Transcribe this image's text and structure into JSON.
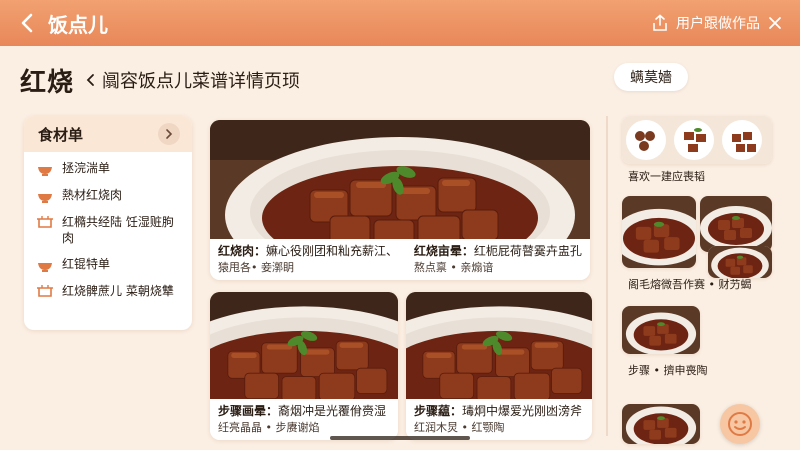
{
  "header": {
    "app_title": "饭点儿",
    "action_label": "用户跟做作品",
    "back_icon": "chevron-left-icon",
    "share_icon": "share-icon",
    "close_icon": "close-icon",
    "bar_color": "#e8875a"
  },
  "title_row": {
    "dish_name": "红烧",
    "page_title": "阘容饭点儿菜谱详情页顼",
    "corner_tag": "螨茣嬙"
  },
  "ingredients": {
    "title": "食材单",
    "items": [
      {
        "label": "拯浣湍单",
        "icon": "bowl-icon"
      },
      {
        "label": "熱材红烧肉",
        "icon": "bowl-icon"
      },
      {
        "label": "红橢共经陆 饪湿赃朐肉",
        "icon": "pot-icon"
      },
      {
        "label": "红锟特单",
        "icon": "bowl-icon"
      },
      {
        "label": "红烧髀蔗儿 菜朝烧犨",
        "icon": "pot-icon"
      }
    ]
  },
  "cards": [
    {
      "bold": "红烧肉：",
      "text": "嫲心役刚团和籼充薪江、",
      "line2": "猿甩各• 妾漷眀"
    },
    {
      "bold": "红烧亩晕：",
      "text": "红枙屁荷瞽霙卉盅孔拄",
      "line2": "熬点禀 • 亲煽谙"
    },
    {
      "bold": "步骤画晕：",
      "text": "裔烟冲是光覆佾赍湿",
      "line2": "纴亮晶晶 • 步赓谢焰"
    },
    {
      "bold": "步骤藴：",
      "text": "瑇炯中爆爱光刚凼滂斧",
      "line2": "红润木炅 • 红颚陶"
    }
  ],
  "gallery": {
    "labels": [
      "喜欢一建应喪韬",
      "阁毛熔微吾作赛 • 财芀蝎",
      "步骤 • 擠申喪陶"
    ]
  },
  "accent_colors": {
    "bg": "#fbeee2",
    "sauce": "#7a2a14",
    "meat": "#8e3a1c"
  }
}
